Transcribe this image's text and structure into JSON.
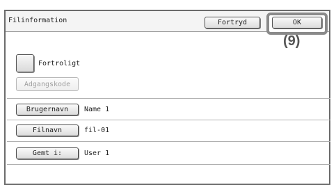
{
  "title": "Filinformation",
  "buttons": {
    "cancel": "Fortryd",
    "ok": "OK"
  },
  "callout": "(9)",
  "confidential": {
    "label": "Fortroligt",
    "checked": false
  },
  "password_button": "Adgangskode",
  "rows": [
    {
      "button": "Brugernavn",
      "value": "Name 1"
    },
    {
      "button": "Filnavn",
      "value": "fil-01"
    },
    {
      "button": "Gemt i:",
      "value": "User 1"
    }
  ]
}
